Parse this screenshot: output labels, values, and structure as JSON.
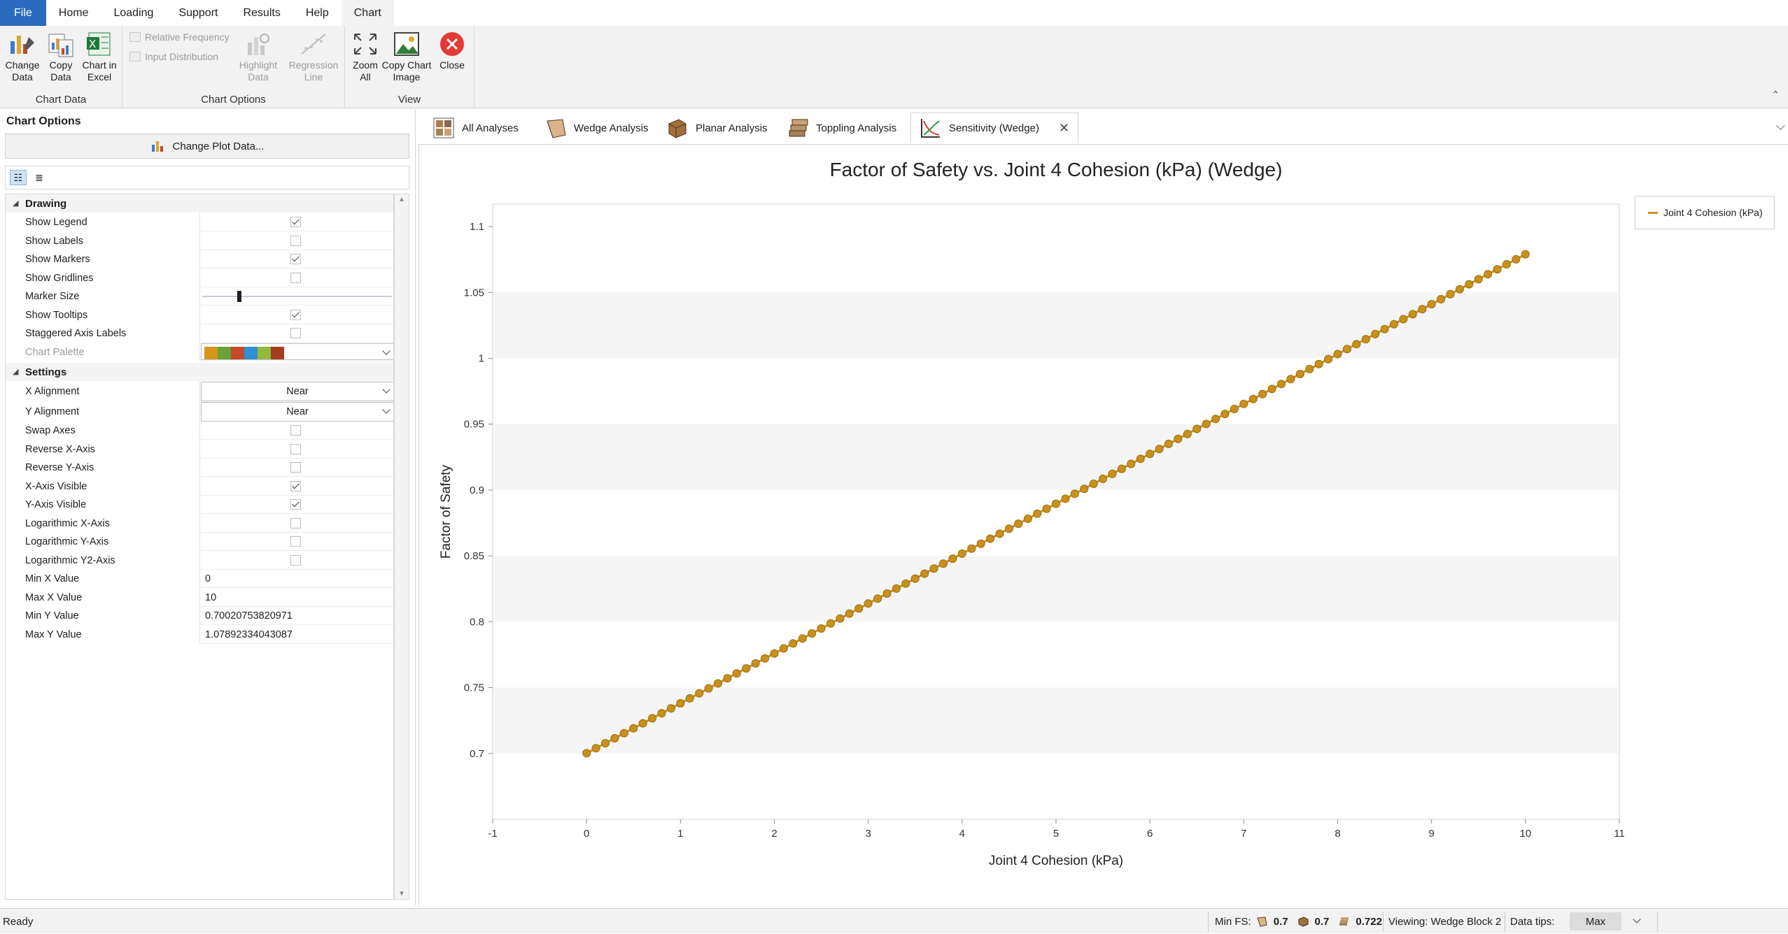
{
  "menu": {
    "items": [
      "File",
      "Home",
      "Loading",
      "Support",
      "Results",
      "Help",
      "Chart"
    ]
  },
  "ribbon": {
    "chart_data_group": {
      "label": "Chart Data",
      "change_data": [
        "Change",
        "Data"
      ],
      "copy_data": [
        "Copy",
        "Data"
      ],
      "chart_in_excel": [
        "Chart in",
        "Excel"
      ]
    },
    "chart_options_group": {
      "label": "Chart Options",
      "relative_frequency": "Relative Frequency",
      "input_distribution": "Input Distribution",
      "highlight_data": [
        "Highlight",
        "Data"
      ],
      "regression_line": [
        "Regression",
        "Line"
      ]
    },
    "view_group": {
      "label": "View",
      "zoom_all": [
        "Zoom",
        "All"
      ],
      "copy_chart_image": [
        "Copy Chart",
        "Image"
      ],
      "close": "Close"
    }
  },
  "left_panel": {
    "title": "Chart Options",
    "change_plot_button": "Change Plot Data...",
    "drawing": {
      "label": "Drawing",
      "rows": [
        {
          "name": "Show Legend",
          "type": "check",
          "checked": true
        },
        {
          "name": "Show Labels",
          "type": "check",
          "checked": false
        },
        {
          "name": "Show Markers",
          "type": "check",
          "checked": true
        },
        {
          "name": "Show Gridlines",
          "type": "check",
          "checked": false
        },
        {
          "name": "Marker Size",
          "type": "slider"
        },
        {
          "name": "Show Tooltips",
          "type": "check",
          "checked": true
        },
        {
          "name": "Staggered Axis Labels",
          "type": "check",
          "checked": false
        },
        {
          "name": "Chart Palette",
          "type": "palette"
        }
      ],
      "palette_colors": [
        "#d4951c",
        "#6aa33a",
        "#c44a2a",
        "#2f8fd0",
        "#8fba3c",
        "#a53b1f"
      ]
    },
    "settings": {
      "label": "Settings",
      "rows": [
        {
          "name": "X Alignment",
          "type": "dropdown",
          "value": "Near"
        },
        {
          "name": "Y Alignment",
          "type": "dropdown",
          "value": "Near"
        },
        {
          "name": "Swap Axes",
          "type": "check",
          "checked": false
        },
        {
          "name": "Reverse X-Axis",
          "type": "check",
          "checked": false
        },
        {
          "name": "Reverse Y-Axis",
          "type": "check",
          "checked": false
        },
        {
          "name": "X-Axis Visible",
          "type": "check",
          "checked": true
        },
        {
          "name": "Y-Axis Visible",
          "type": "check",
          "checked": true
        },
        {
          "name": "Logarithmic X-Axis",
          "type": "check",
          "checked": false
        },
        {
          "name": "Logarithmic Y-Axis",
          "type": "check",
          "checked": false
        },
        {
          "name": "Logarithmic Y2-Axis",
          "type": "check",
          "checked": false
        },
        {
          "name": "Min X Value",
          "type": "text",
          "value": "0"
        },
        {
          "name": "Max X Value",
          "type": "text",
          "value": "10"
        },
        {
          "name": "Min Y Value",
          "type": "text",
          "value": "0.70020753820971"
        },
        {
          "name": "Max Y Value",
          "type": "text",
          "value": "1.07892334043087"
        }
      ]
    }
  },
  "tabs": [
    {
      "label": "All Analyses",
      "icon": "all-analyses-icon"
    },
    {
      "label": "Wedge Analysis",
      "icon": "wedge-icon"
    },
    {
      "label": "Planar Analysis",
      "icon": "planar-icon"
    },
    {
      "label": "Toppling Analysis",
      "icon": "toppling-icon"
    },
    {
      "label": "Sensitivity (Wedge)",
      "icon": "sensitivity-chart-icon",
      "active": true
    }
  ],
  "chart_data": {
    "type": "line",
    "title": "Factor of Safety vs. Joint 4 Cohesion (kPa) (Wedge)",
    "xlabel": "Joint 4 Cohesion (kPa)",
    "ylabel": "Factor of Safety",
    "xlim": [
      -1,
      11
    ],
    "ylim": [
      0.65,
      1.117
    ],
    "x_ticks": [
      -1,
      0,
      1,
      2,
      3,
      4,
      5,
      6,
      7,
      8,
      9,
      10,
      11
    ],
    "y_ticks": [
      0.7,
      0.75,
      0.8,
      0.85,
      0.9,
      0.95,
      1,
      1.05,
      1.1
    ],
    "y_tick_labels": [
      "0.7",
      "0.75",
      "0.8",
      "0.85",
      "0.9",
      "0.95",
      "1",
      "1.05",
      "1.1"
    ],
    "grid": false,
    "legend_position": "top-right",
    "series": [
      {
        "name": "Joint 4 Cohesion (kPa)",
        "color": "#c9901b",
        "x_start": 0,
        "x_end": 10,
        "x_step": 0.1,
        "y_start": 0.70020753820971,
        "y_end": 1.07892334043087
      }
    ]
  },
  "legend": {
    "label": "Joint 4 Cohesion (kPa)"
  },
  "status": {
    "ready": "Ready",
    "min_fs_label": "Min FS:",
    "fs_wedge": "0.7",
    "fs_planar": "0.7",
    "fs_toppling": "0.722",
    "viewing": "Viewing: Wedge Block 2",
    "data_tips": "Data tips:",
    "data_tips_value": "Max"
  }
}
